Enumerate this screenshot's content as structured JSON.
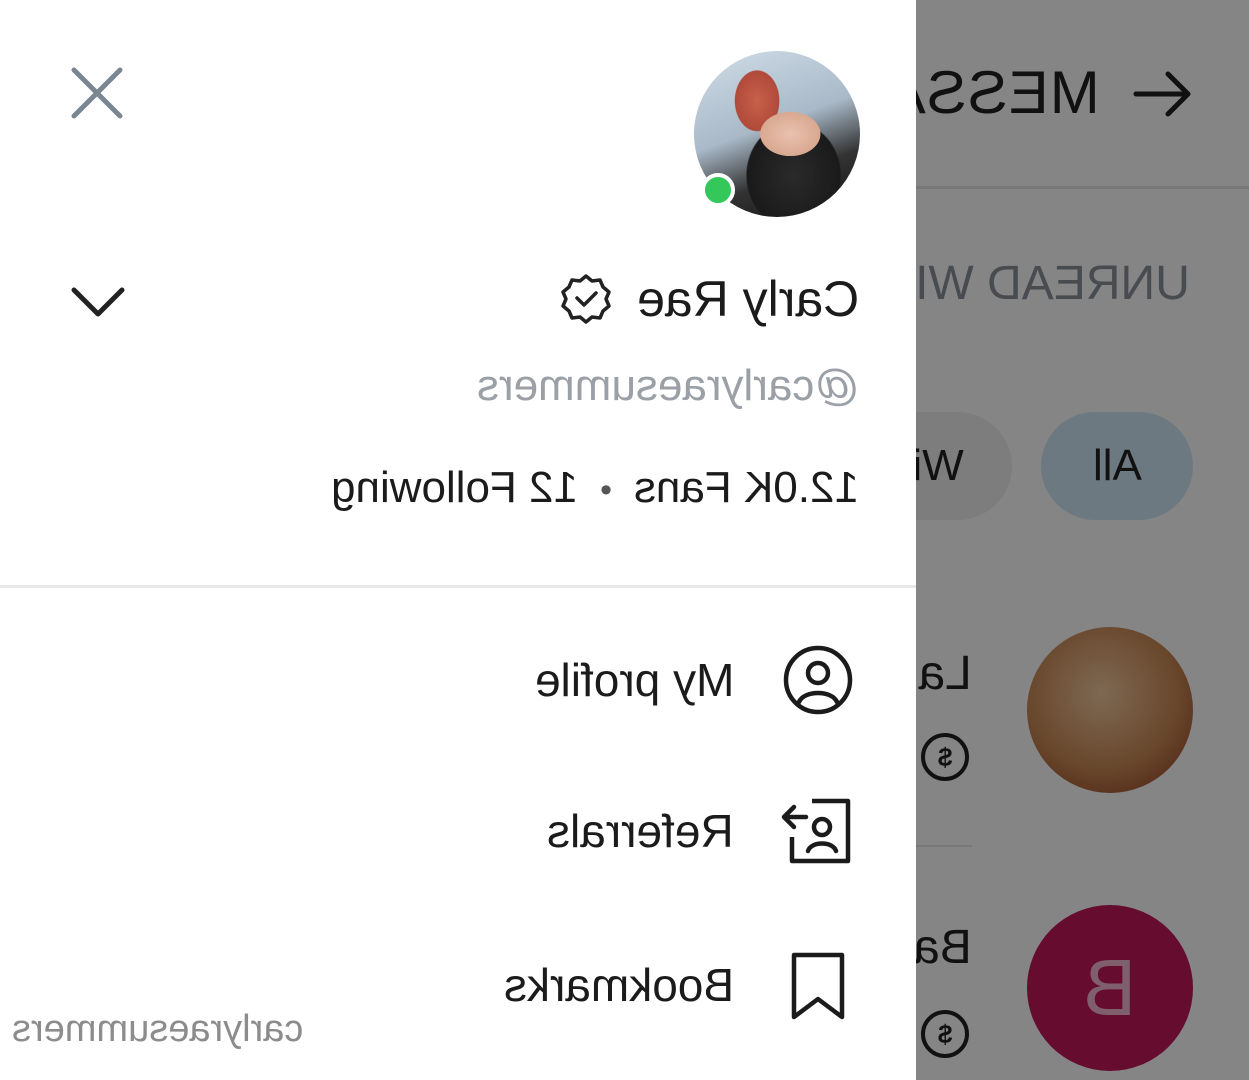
{
  "background": {
    "title": "MESSAGES",
    "subtitle": "UNREAD WITH TIPS",
    "filters": [
      {
        "label": "All"
      },
      {
        "label": "With tips"
      }
    ],
    "chats": [
      {
        "name": "Laura",
        "avatar_letter": ""
      },
      {
        "name": "Barbara",
        "avatar_letter": "B"
      }
    ],
    "coin_symbol": "$"
  },
  "drawer": {
    "profile": {
      "name": "Carly Rae",
      "handle": "@carlyraesummers",
      "fans": "12.0K Fans",
      "separator": "•",
      "following": "12 Following",
      "online": true
    },
    "menu": [
      {
        "label": "My profile",
        "icon": "user-circle-icon"
      },
      {
        "label": "Referrals",
        "icon": "referral-icon"
      },
      {
        "label": "Bookmarks",
        "icon": "bookmark-icon"
      }
    ]
  },
  "watermark": "carlyraesummers",
  "colors": {
    "online": "#34c759",
    "chip_active": "#cfe9f7",
    "avatar_b": "#c2185b",
    "muted": "#9aa0a6"
  }
}
